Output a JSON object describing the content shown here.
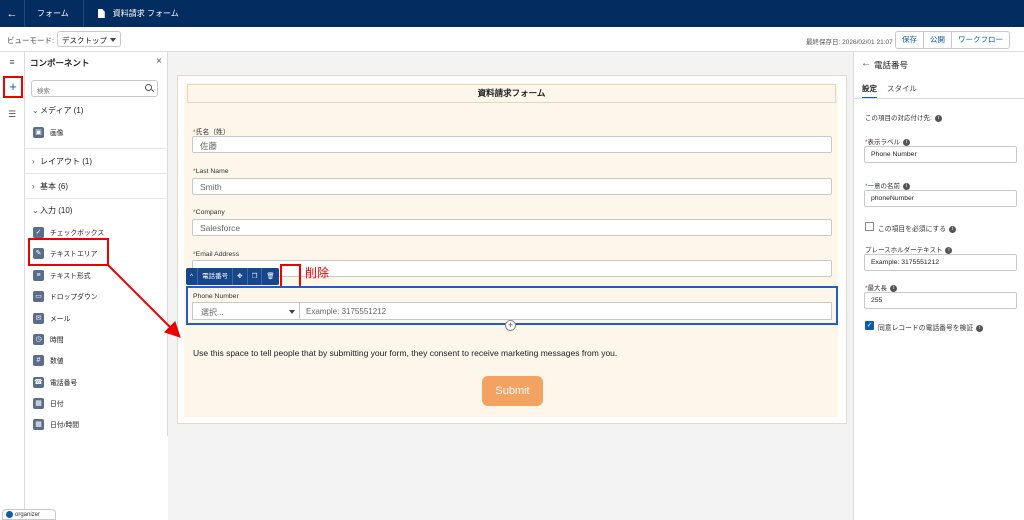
{
  "topbar": {
    "back_icon": "←",
    "crumb1": "フォーム",
    "crumb2": "資料請求 フォーム"
  },
  "toolbar": {
    "view_mode_label": "ビューモード:",
    "view_mode_value": "デスクトップ",
    "last_saved": "最終保存日: 2026/02/01 21:07",
    "save": "保存",
    "publish": "公開",
    "workflow": "ワークフロー"
  },
  "rail": {
    "list_icon": "≡",
    "plus": "+",
    "layers_icon": "☰"
  },
  "components": {
    "title": "コンポーネント",
    "close": "×",
    "search_placeholder": "検索",
    "media": {
      "label": "メディア (1)",
      "items": [
        "画像"
      ]
    },
    "layout": {
      "label": "レイアウト (1)"
    },
    "basic": {
      "label": "基本 (6)"
    },
    "input": {
      "label": "入力 (10)",
      "items": [
        "チェックボックス",
        "テキストエリア",
        "テキスト形式",
        "ドロップダウン",
        "メール",
        "時間",
        "数値",
        "電話番号",
        "日付",
        "日付/時間"
      ]
    }
  },
  "form": {
    "title": "資料請求フォーム",
    "fields": [
      {
        "label": "氏名（姓）",
        "value": "佐藤"
      },
      {
        "label": "Last Name",
        "value": "Smith"
      },
      {
        "label": "Company",
        "value": "Salesforce"
      },
      {
        "label": "Email Address",
        "value": ""
      }
    ],
    "field_toolbar": {
      "collapse": "^",
      "type": "電話番号",
      "move": "✥",
      "copy": "❐",
      "delete": "🗑"
    },
    "delete_note": "削除",
    "phone": {
      "label": "Phone Number",
      "select_placeholder": "選択...",
      "input_placeholder": "Example: 3175551212"
    },
    "add": "+",
    "consent": "Use this space to tell people that by submitting your form, they consent to receive marketing messages from you.",
    "submit": "Submit"
  },
  "props": {
    "title": "電話番号",
    "tab_settings": "設定",
    "tab_style": "スタイル",
    "mapping_label": "この項目の対応付け先:",
    "display_label_label": "表示ラベル",
    "display_label_value": "Phone Number",
    "unique_name_label": "一意の名前",
    "unique_name_value": "phoneNumber",
    "required_label": "この項目を必須にする",
    "placeholder_label": "プレースホルダーテキスト",
    "placeholder_value": "Example: 3175551212",
    "max_length_label": "最大長",
    "max_length_value": "255",
    "verify_label": "同意レコードの電話番号を検証"
  },
  "badge": "organizer",
  "colors": {
    "topbar": "#032d60",
    "accent": "#0b5cab",
    "submit": "#f4a261",
    "annotation": "#ee0000"
  }
}
